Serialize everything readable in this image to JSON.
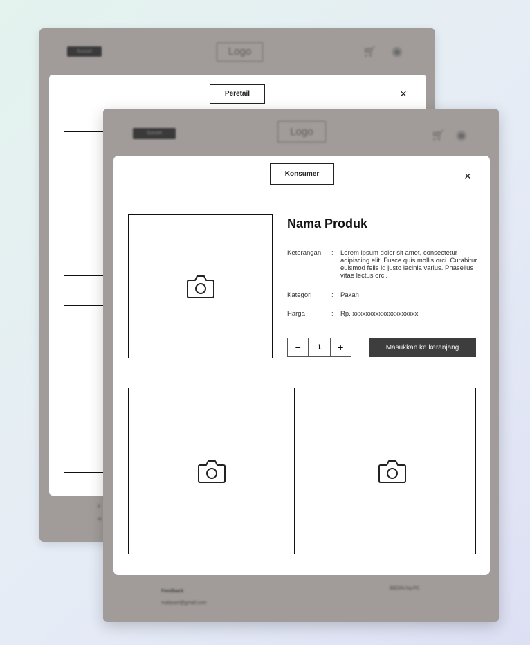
{
  "back_window": {
    "logo": "Logo",
    "login_label": "Sunset",
    "mode_label": "Peretail",
    "close_symbol": "×"
  },
  "front_window": {
    "logo": "Logo",
    "login_label": "Sunset",
    "mode_label": "Konsumer",
    "close_symbol": "×",
    "product": {
      "name": "Nama Produk",
      "description_label": "Keterangan",
      "description": "Lorem ipsum dolor sit amet, consectetur adipiscing elit. Fusce quis mollis orci. Curabitur euismod felis id justo lacinia varius. Phasellus vitae lectus orci.",
      "category_label": "Kategori",
      "category": "Pakan",
      "price_label": "Harga",
      "price": "Rp. xxxxxxxxxxxxxxxxxxxx",
      "separator": ":"
    },
    "quantity": {
      "minus": "−",
      "value": "1",
      "plus": "+"
    },
    "add_to_cart_label": "Masukkan ke keranjang",
    "footer": {
      "title": "Feedback",
      "email": "malasari@gmail.com",
      "right_text": "BBDIN-hq-PC"
    }
  },
  "icons": {
    "camera": "camera-icon",
    "cart": "cart-icon",
    "profile": "profile-icon"
  }
}
